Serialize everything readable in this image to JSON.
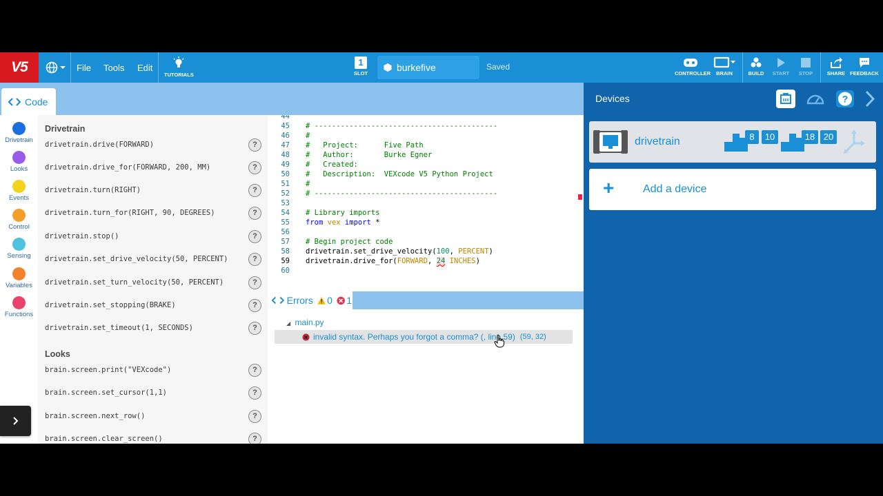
{
  "app": {
    "logo": "V5"
  },
  "topbar": {
    "menus": [
      "File",
      "Tools",
      "Edit"
    ],
    "tutorials_label": "TUTORIALS",
    "slot_number": "1",
    "slot_label": "SLOT",
    "project_name": "burkefive",
    "save_status": "Saved",
    "controller_label": "CONTROLLER",
    "brain_label": "BRAIN",
    "build_label": "BUILD",
    "start_label": "START",
    "stop_label": "STOP",
    "share_label": "SHARE",
    "feedback_label": "FEEDBACK"
  },
  "tabs": {
    "code": "Code"
  },
  "categories": [
    {
      "label": "Drivetrain",
      "color": "#1a6ee0"
    },
    {
      "label": "Looks",
      "color": "#9a5ce6"
    },
    {
      "label": "Events",
      "color": "#f2d21b"
    },
    {
      "label": "Control",
      "color": "#f2a02b"
    },
    {
      "label": "Sensing",
      "color": "#4fc2dd"
    },
    {
      "label": "Variables",
      "color": "#f2832a"
    },
    {
      "label": "Functions",
      "color": "#e8426d"
    }
  ],
  "toolbox": {
    "drivetrain_heading": "Drivetrain",
    "drivetrain_cmds": [
      "drivetrain.drive(FORWARD)",
      "drivetrain.drive_for(FORWARD, 200, MM)",
      "drivetrain.turn(RIGHT)",
      "drivetrain.turn_for(RIGHT, 90, DEGREES)",
      "drivetrain.stop()",
      "drivetrain.set_drive_velocity(50, PERCENT)",
      "drivetrain.set_turn_velocity(50, PERCENT)",
      "drivetrain.set_stopping(BRAKE)",
      "drivetrain.set_timeout(1, SECONDS)"
    ],
    "looks_heading": "Looks",
    "looks_cmds": [
      "brain.screen.print(\"VEXcode\")",
      "brain.screen.set_cursor(1,1)",
      "brain.screen.next_row()",
      "brain.screen.clear_screen()"
    ],
    "help_glyph": "?"
  },
  "editor": {
    "lines": [
      {
        "n": "44",
        "text": ""
      },
      {
        "n": "45",
        "text": "# ------------------------------------------"
      },
      {
        "n": "46",
        "text": "#"
      },
      {
        "n": "47",
        "text": "#   Project:      Five Path"
      },
      {
        "n": "48",
        "text": "#   Author:       Burke Egner"
      },
      {
        "n": "49",
        "text": "#   Created:"
      },
      {
        "n": "50",
        "text": "#   Description:  VEXcode V5 Python Project"
      },
      {
        "n": "51",
        "text": "#"
      },
      {
        "n": "52",
        "text": "# ------------------------------------------"
      },
      {
        "n": "53",
        "text": ""
      },
      {
        "n": "54",
        "text": "# Library imports"
      },
      {
        "n": "55",
        "text": ""
      },
      {
        "n": "56",
        "text": ""
      },
      {
        "n": "57",
        "text": "# Begin project code"
      },
      {
        "n": "58",
        "text": ""
      },
      {
        "n": "59",
        "text": ""
      },
      {
        "n": "60",
        "text": ""
      }
    ],
    "line55": {
      "kw1": "from",
      "mod": "vex",
      "kw2": "import",
      "rest": " *"
    },
    "line58": {
      "pre": "drivetrain.set_drive_velocity(",
      "num": "100",
      "sep": ", ",
      "const": "PERCENT",
      "post": ")"
    },
    "line59": {
      "pre": "drivetrain.drive_for(",
      "const1": "FORWARD",
      "sep": ", ",
      "num": "24",
      "space": " ",
      "const2": "INCHES",
      "post": ")"
    }
  },
  "errors": {
    "title": "Errors",
    "warning_count": "0",
    "error_count": "1",
    "file": "main.py",
    "message": "invalid syntax. Perhaps you forgot a comma? (<string>, line 59)",
    "message_shown": "invalid syntax. Perhaps you forgot a comma? (, line 59)",
    "location": "(59, 32)"
  },
  "devices": {
    "title": "Devices",
    "device_name": "drivetrain",
    "ports": [
      "8",
      "10",
      "18",
      "20"
    ],
    "add_label": "Add a device",
    "add_glyph": "+"
  }
}
